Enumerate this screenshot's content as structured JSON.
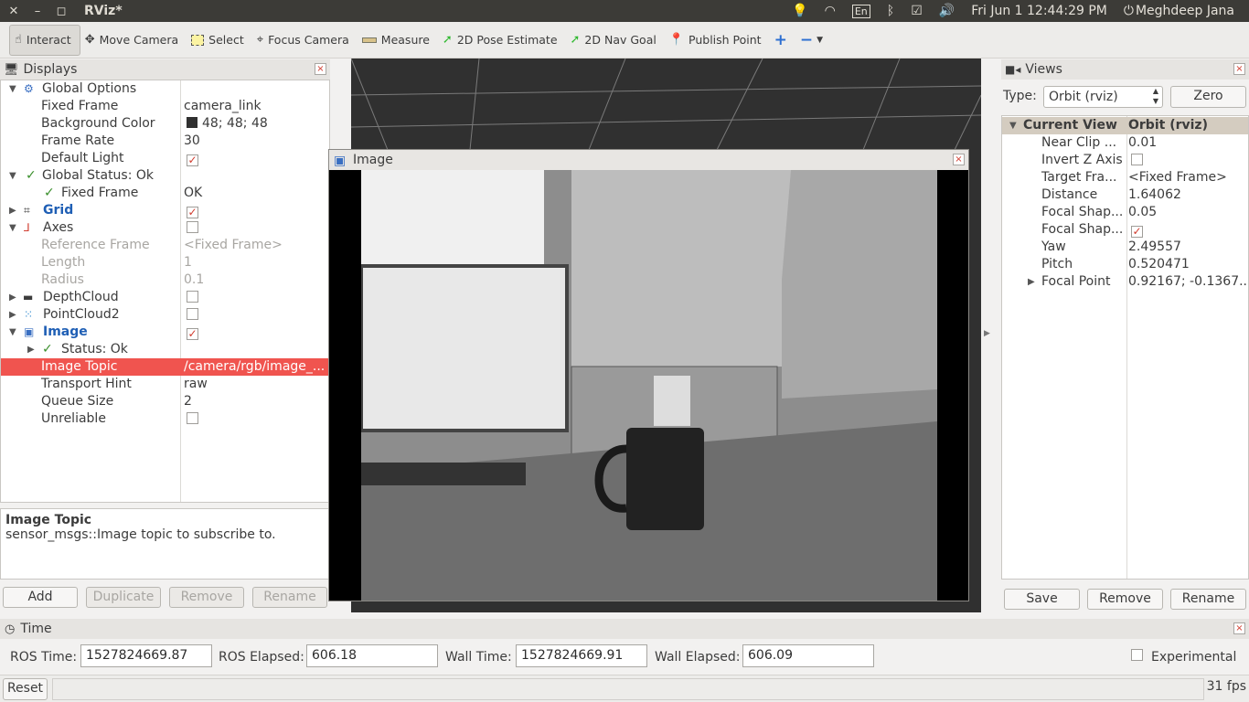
{
  "window": {
    "title": "RViz*",
    "close": "✕",
    "minimize": "–",
    "maximize": "◻"
  },
  "tray": {
    "lang": "En",
    "datetime": "Fri Jun  1 12:44:29 PM",
    "user": "Meghdeep Jana"
  },
  "toolbar": {
    "interact": "Interact",
    "move_camera": "Move Camera",
    "select": "Select",
    "focus_camera": "Focus Camera",
    "measure": "Measure",
    "pose_estimate": "2D Pose Estimate",
    "nav_goal": "2D Nav Goal",
    "publish_point": "Publish Point"
  },
  "displays": {
    "title": "Displays",
    "global_options": "Global Options",
    "fixed_frame_label": "Fixed Frame",
    "fixed_frame_value": "camera_link",
    "bg_color_label": "Background Color",
    "bg_color_value": "48; 48; 48",
    "frame_rate_label": "Frame Rate",
    "frame_rate_value": "30",
    "default_light_label": "Default Light",
    "global_status": "Global Status: Ok",
    "gs_fixed_frame_label": "Fixed Frame",
    "gs_fixed_frame_value": "OK",
    "grid": "Grid",
    "axes": "Axes",
    "ref_frame_label": "Reference Frame",
    "ref_frame_value": "<Fixed Frame>",
    "length_label": "Length",
    "length_value": "1",
    "radius_label": "Radius",
    "radius_value": "0.1",
    "depthcloud": "DepthCloud",
    "pointcloud2": "PointCloud2",
    "image": "Image",
    "status_ok": "Status: Ok",
    "image_topic_label": "Image Topic",
    "image_topic_value": "/camera/rgb/image_...",
    "transport_hint_label": "Transport Hint",
    "transport_hint_value": "raw",
    "queue_size_label": "Queue Size",
    "queue_size_value": "2",
    "unreliable_label": "Unreliable",
    "desc_title": "Image Topic",
    "desc_text": "sensor_msgs::Image topic to subscribe to.",
    "add": "Add",
    "duplicate": "Duplicate",
    "remove": "Remove",
    "rename": "Rename"
  },
  "image_window": {
    "title": "Image"
  },
  "views": {
    "title": "Views",
    "type_label": "Type:",
    "type_value": "Orbit (rviz)",
    "zero": "Zero",
    "current_view": "Current View",
    "current_view_value": "Orbit (rviz)",
    "near_clip_label": "Near Clip ...",
    "near_clip_value": "0.01",
    "invert_z_label": "Invert Z Axis",
    "target_frame_label": "Target Fra...",
    "target_frame_value": "<Fixed Frame>",
    "distance_label": "Distance",
    "distance_value": "1.64062",
    "focal_shape1_label": "Focal Shap...",
    "focal_shape1_value": "0.05",
    "focal_shape2_label": "Focal Shap...",
    "yaw_label": "Yaw",
    "yaw_value": "2.49557",
    "pitch_label": "Pitch",
    "pitch_value": "0.520471",
    "focal_point_label": "Focal Point",
    "focal_point_value": "0.92167; -0.1367...",
    "save": "Save",
    "remove": "Remove",
    "rename": "Rename"
  },
  "time": {
    "title": "Time",
    "ros_time_label": "ROS Time:",
    "ros_time_value": "1527824669.87",
    "ros_elapsed_label": "ROS Elapsed:",
    "ros_elapsed_value": "606.18",
    "wall_time_label": "Wall Time:",
    "wall_time_value": "1527824669.91",
    "wall_elapsed_label": "Wall Elapsed:",
    "wall_elapsed_value": "606.09",
    "experimental": "Experimental"
  },
  "statusbar": {
    "reset": "Reset",
    "fps": "31 fps"
  }
}
